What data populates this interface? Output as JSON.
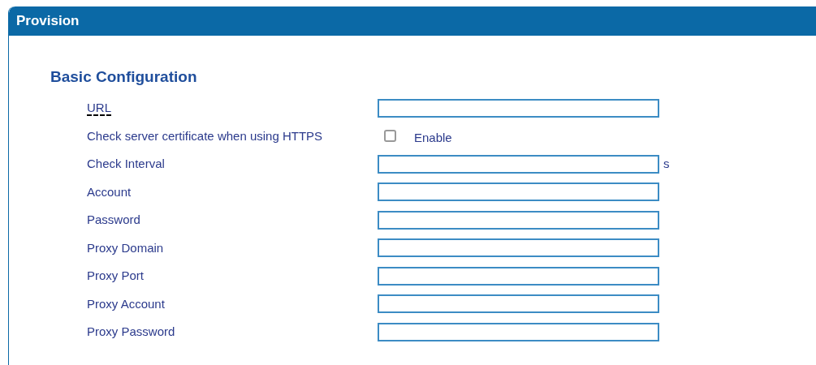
{
  "panel": {
    "title": "Provision"
  },
  "section": {
    "title": "Basic Configuration"
  },
  "fields": [
    {
      "kind": "text",
      "label": "URL",
      "has_tooltip": true
    },
    {
      "kind": "checkbox",
      "label": "Check server certificate when using HTTPS",
      "has_tooltip": false,
      "checked": false,
      "option": "Enable"
    },
    {
      "kind": "text",
      "label": "Check Interval",
      "has_tooltip": false,
      "unit": "s"
    },
    {
      "kind": "text",
      "label": "Account",
      "has_tooltip": false
    },
    {
      "kind": "text",
      "label": "Password",
      "has_tooltip": false
    },
    {
      "kind": "text",
      "label": "Proxy Domain",
      "has_tooltip": false
    },
    {
      "kind": "text",
      "label": "Proxy Port",
      "has_tooltip": false
    },
    {
      "kind": "text",
      "label": "Proxy Account",
      "has_tooltip": false
    },
    {
      "kind": "text",
      "label": "Proxy Password",
      "has_tooltip": false
    }
  ]
}
